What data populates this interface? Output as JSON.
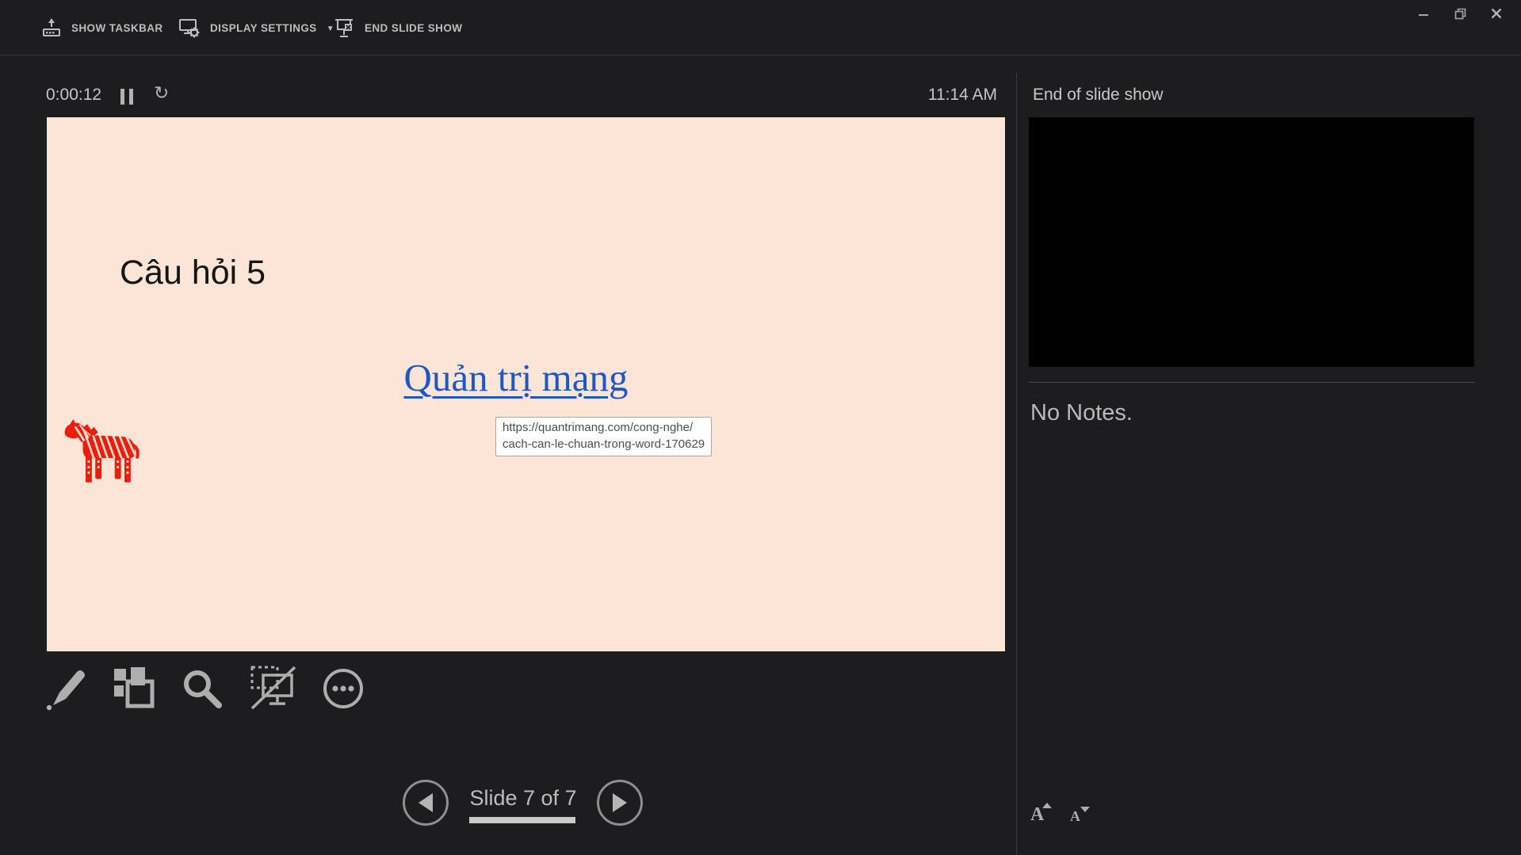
{
  "toolbar": {
    "show_taskbar_label": "SHOW TASKBAR",
    "display_settings_label": "DISPLAY SETTINGS",
    "display_settings_caret": "▼",
    "end_slide_show_label": "END SLIDE SHOW"
  },
  "status": {
    "timer_elapsed": "0:00:12",
    "reset_glyph": "↻",
    "clock": "11:14 AM"
  },
  "slide": {
    "title": "Câu hỏi 5",
    "link_text": "Quản trị mạng",
    "tooltip_line1": "https://quantrimang.com/cong-nghe/",
    "tooltip_line2": "cach-can-le-chuan-trong-word-170629"
  },
  "navigation": {
    "slide_label": "Slide 7 of 7",
    "progress_percent": 100
  },
  "notes_panel": {
    "header": "End of slide show",
    "notes_text": "No Notes.",
    "increase_font_label": "A",
    "decrease_font_label": "A"
  },
  "colors": {
    "slide_background": "#fbe5d6",
    "hyperlink_blue": "#2057c5",
    "zebra_red": "#ed1c0b",
    "ui_text": "#c8c8c8",
    "window_background": "#1d1d1f"
  }
}
